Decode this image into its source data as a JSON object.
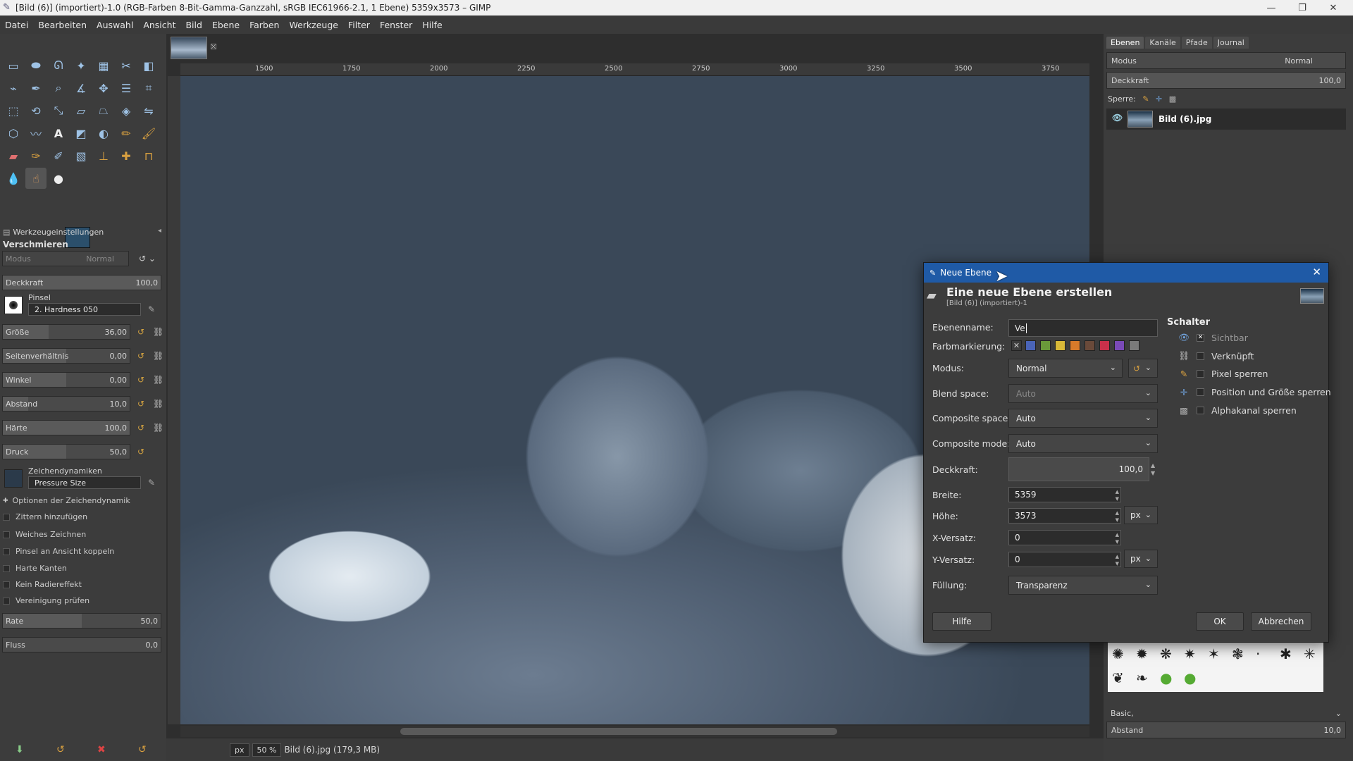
{
  "window": {
    "title": "[Bild (6)] (importiert)-1.0 (RGB-Farben 8-Bit-Gamma-Ganzzahl, sRGB IEC61966-2.1, 1 Ebene) 5359x3573 – GIMP"
  },
  "menu": [
    "Datei",
    "Bearbeiten",
    "Auswahl",
    "Ansicht",
    "Bild",
    "Ebene",
    "Farben",
    "Werkzeuge",
    "Filter",
    "Fenster",
    "Hilfe"
  ],
  "tool_options": {
    "header": "Werkzeugeinstellungen",
    "tool_name": "Verschmieren",
    "mode_label": "Modus",
    "mode_value": "Normal",
    "opacity_label": "Deckkraft",
    "opacity_value": "100,0",
    "brush_label": "Pinsel",
    "brush_name": "2. Hardness 050",
    "size_label": "Größe",
    "size_value": "36,00",
    "aspect_label": "Seitenverhältnis",
    "aspect_value": "0,00",
    "angle_label": "Winkel",
    "angle_value": "0,00",
    "spacing_label": "Abstand",
    "spacing_value": "10,0",
    "hardness_label": "Härte",
    "hardness_value": "100,0",
    "pressure_label": "Druck",
    "pressure_value": "50,0",
    "dynamics_label": "Zeichendynamiken",
    "dynamics_name": "Pressure Size",
    "checks": [
      "Optionen der Zeichendynamik",
      "Zittern hinzufügen",
      "Weiches Zeichnen",
      "Pinsel an Ansicht koppeln",
      "Harte Kanten",
      "Kein Radiereffekt",
      "Vereinigung prüfen"
    ],
    "rate_label": "Rate",
    "rate_value": "50,0",
    "flow_label": "Fluss",
    "flow_value": "0,0"
  },
  "ruler": [
    "1500",
    "1750",
    "2000",
    "2250",
    "2500",
    "2750",
    "3000",
    "3250",
    "3500",
    "3750"
  ],
  "status": {
    "unit": "px",
    "zoom": "50 %",
    "info": "Bild (6).jpg (179,3 MB)"
  },
  "layers_dock": {
    "tabs": [
      "Ebenen",
      "Kanäle",
      "Pfade",
      "Journal"
    ],
    "mode_label": "Modus",
    "mode_value": "Normal",
    "opacity_label": "Deckkraft",
    "opacity_value": "100,0",
    "lock_label": "Sperre:",
    "layer_name": "Bild (6).jpg",
    "brush_set": "Basic,",
    "spacing_label": "Abstand",
    "spacing_value": "10,0"
  },
  "dialog": {
    "title": "Neue Ebene",
    "heading": "Eine neue Ebene erstellen",
    "subheading": "[Bild (6)] (importiert)-1",
    "labels": {
      "name": "Ebenenname:",
      "color_tag": "Farbmarkierung:",
      "mode": "Modus:",
      "blend": "Blend space:",
      "comp_space": "Composite space:",
      "comp_mode": "Composite mode:",
      "opacity": "Deckkraft:",
      "width": "Breite:",
      "height": "Höhe:",
      "xoff": "X-Versatz:",
      "yoff": "Y-Versatz:",
      "fill": "Füllung:"
    },
    "values": {
      "name": "Ve",
      "mode": "Normal",
      "blend": "Auto",
      "comp_space": "Auto",
      "comp_mode": "Auto",
      "opacity": "100,0",
      "width": "5359",
      "height": "3573",
      "unit": "px",
      "xoff": "0",
      "yoff": "0",
      "unit2": "px",
      "fill": "Transparenz"
    },
    "color_tags": [
      "#4a64b8",
      "#6a9a3a",
      "#d8b838",
      "#d87a2a",
      "#6a4a3a",
      "#c8304a",
      "#7a4ab8",
      "#7a7a7a"
    ],
    "switches_title": "Schalter",
    "switches": [
      "Sichtbar",
      "Verknüpft",
      "Pixel sperren",
      "Position und Größe sperren",
      "Alphakanal sperren"
    ],
    "buttons": {
      "help": "Hilfe",
      "ok": "OK",
      "cancel": "Abbrechen"
    }
  }
}
